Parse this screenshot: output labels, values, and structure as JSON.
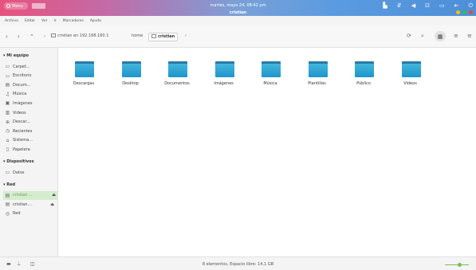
{
  "panel": {
    "menu_label": "Menu",
    "clock": "martes, mayo 24, 08:42 pm",
    "window_title": "cristian",
    "tray_icons": [
      "app-icon",
      "network-icon",
      "volume-icon",
      "lock-icon",
      "battery-icon",
      "arrow-icon",
      "power-icon"
    ]
  },
  "window_controls": {
    "colors": [
      "#f4c20d",
      "#2fbf4f",
      "#e24b3a"
    ]
  },
  "menubar": {
    "items": [
      "Archivo",
      "Editar",
      "Ver",
      "Ir",
      "Marcadores",
      "Ayuda"
    ]
  },
  "location": {
    "segments": [
      {
        "label": "cristian en 192.168.160.1"
      },
      {
        "label": "home"
      },
      {
        "label": "cristian"
      }
    ]
  },
  "sidebar": {
    "sections": [
      {
        "title": "Mi equipo",
        "items": [
          {
            "label": "Carpet...",
            "icon": "folder-icon"
          },
          {
            "label": "Escritorio",
            "icon": "desktop-icon"
          },
          {
            "label": "Docum...",
            "icon": "documents-icon"
          },
          {
            "label": "Música",
            "icon": "music-icon"
          },
          {
            "label": "Imágenes",
            "icon": "pictures-icon"
          },
          {
            "label": "Videos",
            "icon": "videos-icon"
          },
          {
            "label": "Descar...",
            "icon": "downloads-icon"
          },
          {
            "label": "Recientes",
            "icon": "recent-icon"
          },
          {
            "label": "Sistema...",
            "icon": "system-icon"
          },
          {
            "label": "Papelera",
            "icon": "trash-icon"
          }
        ]
      },
      {
        "title": "Dispositivos",
        "items": [
          {
            "label": "Datos",
            "icon": "drive-icon"
          }
        ]
      },
      {
        "title": "Red",
        "items": [
          {
            "label": "cristian ...",
            "icon": "network-share-icon",
            "active": true
          },
          {
            "label": "cristian....",
            "icon": "network-share-icon"
          },
          {
            "label": "Red",
            "icon": "network-icon"
          }
        ]
      }
    ]
  },
  "folders": [
    "Descargas",
    "Desktop",
    "Documentos",
    "Imágenes",
    "Música",
    "Plantillas",
    "Público",
    "Videos"
  ],
  "statusbar": {
    "text": "8 elementos, Espacio libre: 14,1 GB",
    "zoom_level": 0.6
  },
  "colors": {
    "folder": "#1f95c9",
    "accent_green": "#7bbf56"
  }
}
